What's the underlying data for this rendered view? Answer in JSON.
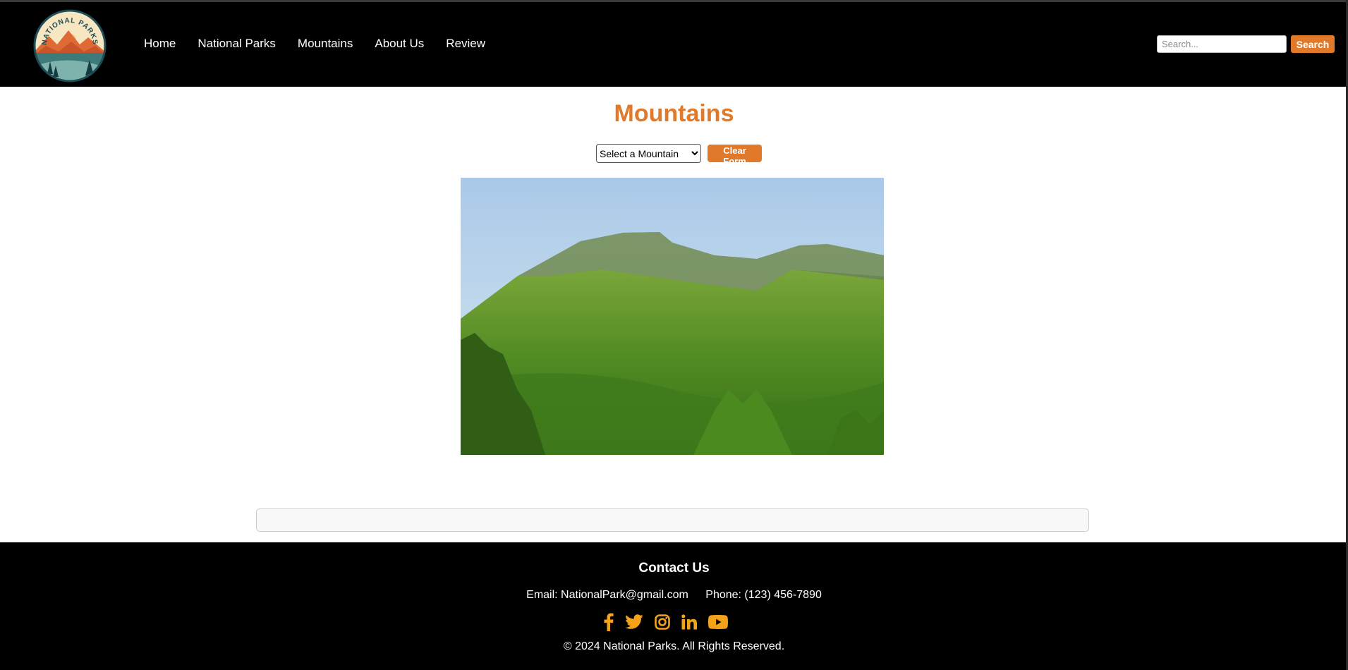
{
  "header": {
    "nav": [
      "Home",
      "National Parks",
      "Mountains",
      "About Us",
      "Review"
    ],
    "logo_text": "NATIONAL PARKS",
    "search": {
      "placeholder": "Search...",
      "value": "",
      "button_label": "Search"
    }
  },
  "main": {
    "title": "Mountains",
    "select": {
      "selected": "Select a Mountain"
    },
    "clear_label": "Clear Form",
    "result_text": ""
  },
  "footer": {
    "title": "Contact Us",
    "email": "Email: NationalPark@gmail.com",
    "phone": "Phone: (123) 456-7890",
    "social_icons": [
      "facebook-icon",
      "twitter-icon",
      "instagram-icon",
      "linkedin-icon",
      "youtube-icon"
    ],
    "copyright": "© 2024 National Parks. All Rights Reserved."
  },
  "colors": {
    "accent": "#e07a2a",
    "social": "#f5a21b",
    "header_bg": "#000000",
    "footer_bg": "#000000"
  }
}
